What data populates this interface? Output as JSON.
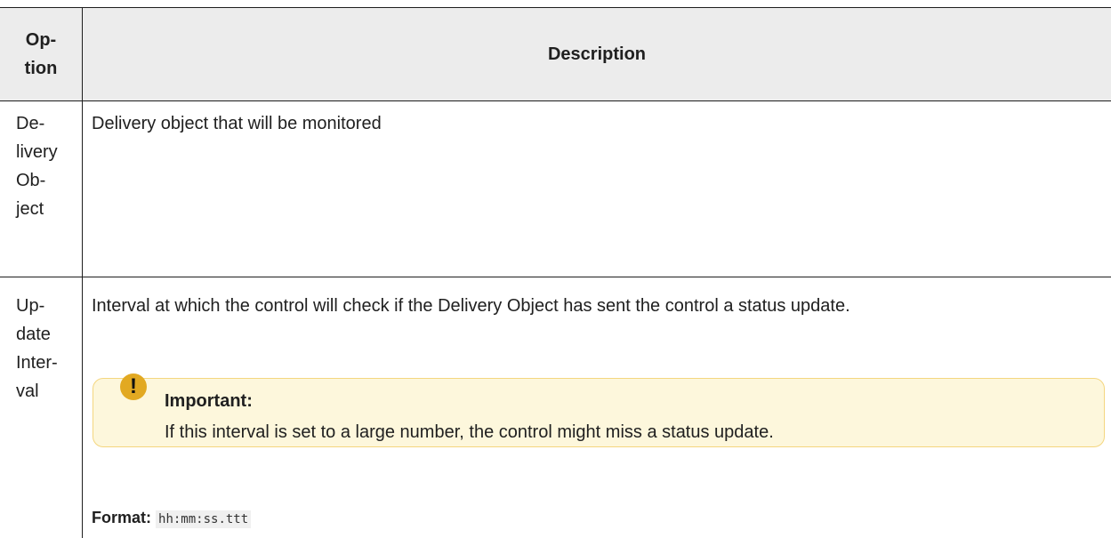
{
  "table": {
    "header": {
      "option": "Op- tion",
      "option_line1": "Op-",
      "option_line2": "tion",
      "description": "Description"
    },
    "rows": [
      {
        "option_lines": [
          "De-",
          "livery",
          "Ob-",
          "ject"
        ],
        "description": "Delivery object that will be monitored"
      },
      {
        "option_lines": [
          "Up-",
          "date",
          "Inter-",
          "val"
        ],
        "description": "Interval at which the control will check if the Delivery Object has sent the control a status update.",
        "note": {
          "icon": "exclamation-icon",
          "title": "Important:",
          "body": "If this interval is set to a large number, the control might miss a status update."
        },
        "format_label": "Format:",
        "format_value": "hh:mm:ss.ttt"
      }
    ]
  },
  "colors": {
    "header_bg": "#ececec",
    "border": "#1e1e1e",
    "note_bg": "#fdf7dc",
    "note_border": "#f4d67f",
    "note_icon": "#e2a922"
  }
}
